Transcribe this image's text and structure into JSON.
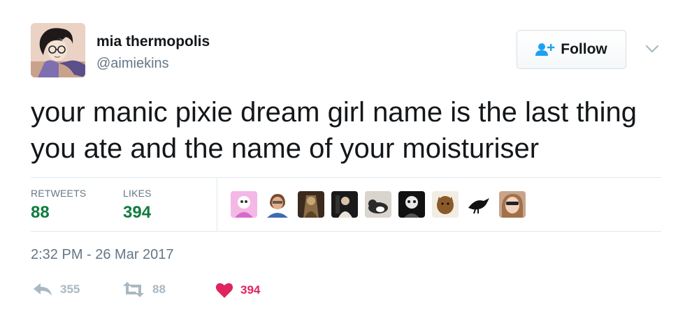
{
  "user": {
    "display_name": "mia thermopolis",
    "handle": "@aimiekins",
    "avatar_icon": "avatar-illustration"
  },
  "follow": {
    "label": "Follow",
    "icon": "add-user-icon",
    "accent_color": "#1da1f2"
  },
  "menu": {
    "icon": "chevron-down-icon"
  },
  "tweet": {
    "text_line1": "your manic pixie dream girl name is the last thing",
    "text_line2": "you ate and the name of your moisturiser"
  },
  "stats": {
    "retweets_label": "RETWEETS",
    "retweets_value": "88",
    "likes_label": "LIKES",
    "likes_value": "394",
    "value_color": "#0f7b3f"
  },
  "likers": [
    {
      "name": "liker-avatar-1"
    },
    {
      "name": "liker-avatar-2"
    },
    {
      "name": "liker-avatar-3"
    },
    {
      "name": "liker-avatar-4"
    },
    {
      "name": "liker-avatar-5"
    },
    {
      "name": "liker-avatar-6"
    },
    {
      "name": "liker-avatar-7"
    },
    {
      "name": "liker-avatar-8"
    },
    {
      "name": "liker-avatar-9"
    }
  ],
  "timestamp": "2:32 PM - 26 Mar 2017",
  "actions": {
    "reply_count": "355",
    "retweet_count": "88",
    "like_count": "394",
    "like_color": "#e0245e"
  }
}
